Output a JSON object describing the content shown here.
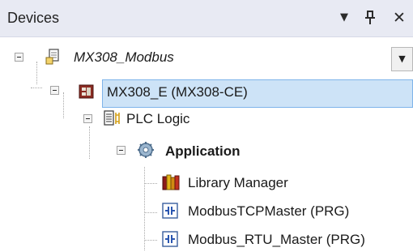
{
  "panel": {
    "title": "Devices",
    "menu_glyph": "▼",
    "pin_glyph": "ᵻ",
    "close_glyph": "✕",
    "dropdown_glyph": "▼"
  },
  "tree": {
    "project": {
      "label": "MX308_Modbus",
      "icon": "project-document-icon"
    },
    "device": {
      "label": "MX308_E (MX308-CE)",
      "icon": "device-icon"
    },
    "plc_logic": {
      "label": "PLC Logic",
      "icon": "plc-logic-icon"
    },
    "application": {
      "label": "Application",
      "icon": "application-gear-icon"
    },
    "children": [
      {
        "label": "Library Manager",
        "icon": "library-books-icon"
      },
      {
        "label": "ModbusTCPMaster (PRG)",
        "icon": "program-pou-icon"
      },
      {
        "label": "Modbus_RTU_Master (PRG)",
        "icon": "program-pou-icon"
      }
    ]
  },
  "colors": {
    "selection": "#cde3f7",
    "selection_border": "#7eb4ea",
    "titlebar": "#e8eaf3"
  }
}
